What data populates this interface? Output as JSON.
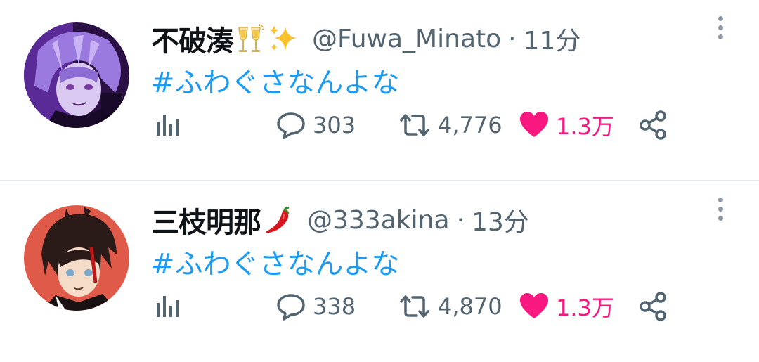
{
  "tweets": [
    {
      "display_name": "不破湊",
      "name_emojis": [
        "clinking-glasses-emoji",
        "sparkles-emoji"
      ],
      "handle": "@Fuwa_Minato",
      "separator": "·",
      "time": "11分",
      "text": "#ふわぐさなんよな",
      "replies": "303",
      "retweets": "4,776",
      "likes": "1.3万",
      "liked": true,
      "avatar": {
        "type": "purple-haired-anime-character",
        "bg": "#3c1b6b",
        "hair": "#9b7ae0"
      }
    },
    {
      "display_name": "三枝明那",
      "name_emojis": [
        "hot-pepper-emoji"
      ],
      "handle": "@333akina",
      "separator": "·",
      "time": "13分",
      "text": "#ふわぐさなんよな",
      "replies": "338",
      "retweets": "4,870",
      "likes": "1.3万",
      "liked": true,
      "avatar": {
        "type": "dark-haired-anime-character",
        "bg": "#e05a4a",
        "hair": "#2a1a18"
      }
    }
  ],
  "colors": {
    "text": "#0f1419",
    "secondary": "#536471",
    "link": "#1d9bf0",
    "like": "#f91880",
    "divider": "#e6e9eb"
  }
}
